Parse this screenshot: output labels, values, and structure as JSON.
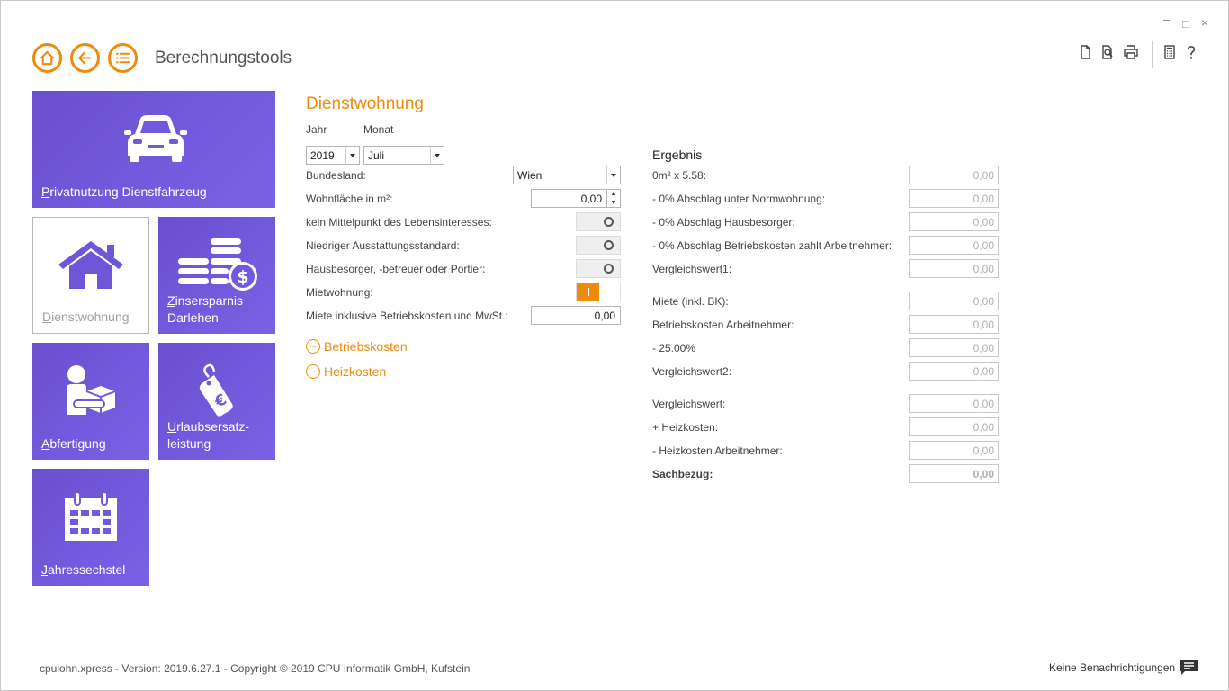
{
  "app": {
    "title": "Berechnungstools"
  },
  "window": {
    "minimize": "–",
    "maximize": "□",
    "close": "×"
  },
  "nav": {
    "home_icon": "home-icon",
    "back_icon": "back-arrow-icon",
    "menu_icon": "list-menu-icon"
  },
  "toolbar": {
    "icons": [
      "document-icon",
      "search-document-icon",
      "print-icon",
      "calculator-icon",
      "help-icon"
    ]
  },
  "tiles": [
    {
      "label": "Privatnutzung Dienstfahrzeug",
      "icon": "car-icon",
      "active": false
    },
    {
      "label": "Dienstwohnung",
      "icon": "house-icon",
      "active": true
    },
    {
      "label": "Zinsersparnis Darlehen",
      "icon": "coins-dollar-icon",
      "active": false
    },
    {
      "label": "Abfertigung",
      "icon": "person-package-icon",
      "active": false
    },
    {
      "label": "Urlaubsersatz-leistung",
      "icon": "euro-tag-icon",
      "active": false
    },
    {
      "label": "Jahressechstel",
      "icon": "calendar-icon",
      "active": false
    }
  ],
  "form": {
    "title": "Dienstwohnung",
    "year_label": "Jahr",
    "month_label": "Monat",
    "year_value": "2019",
    "month_value": "Juli",
    "bundesland_label": "Bundesland:",
    "bundesland_value": "Wien",
    "wohnflaeche_label": "Wohnfläche in m²:",
    "wohnflaeche_value": "0,00",
    "toggles": [
      {
        "label": "kein Mittelpunkt des Lebensinteresses:",
        "on": false
      },
      {
        "label": "Niedriger Ausstattungsstandard:",
        "on": false
      },
      {
        "label": "Hausbesorger, -betreuer oder Portier:",
        "on": false
      },
      {
        "label": "Mietwohnung:",
        "on": true
      }
    ],
    "miete_label": "Miete inklusive Betriebskosten und MwSt.:",
    "miete_value": "0,00",
    "link_betriebskosten": "Betriebskosten",
    "link_heizkosten": "Heizkosten"
  },
  "results": {
    "title": "Ergebnis",
    "rows": [
      {
        "label": "0m² x 5.58:",
        "value": "0,00"
      },
      {
        "label": "- 0% Abschlag unter Normwohnung:",
        "value": "0,00"
      },
      {
        "label": "- 0% Abschlag Hausbesorger:",
        "value": "0,00"
      },
      {
        "label": "- 0% Abschlag Betriebskosten zahlt Arbeitnehmer:",
        "value": "0,00"
      },
      {
        "label": "Vergleichswert1:",
        "value": "0,00"
      },
      {
        "label": "Miete (inkl. BK):",
        "value": "0,00"
      },
      {
        "label": "Betriebskosten Arbeitnehmer:",
        "value": "0,00"
      },
      {
        "label": "- 25.00%",
        "value": "0,00"
      },
      {
        "label": "Vergleichswert2:",
        "value": "0,00"
      },
      {
        "label": "Vergleichswert:",
        "value": "0,00"
      },
      {
        "label": "+ Heizkosten:",
        "value": "0,00"
      },
      {
        "label": "- Heizkosten Arbeitnehmer:",
        "value": "0,00"
      },
      {
        "label": "Sachbezug:",
        "value": "0,00"
      }
    ]
  },
  "footer": {
    "version_text": "cpulohn.xpress - Version: 2019.6.27.1 - Copyright ©  2019 CPU Informatik GmbH, Kufstein",
    "notifications": "Keine Benachrichtigungen"
  },
  "colors": {
    "accent": "#f08a0b",
    "tile": "#6f55d8"
  }
}
